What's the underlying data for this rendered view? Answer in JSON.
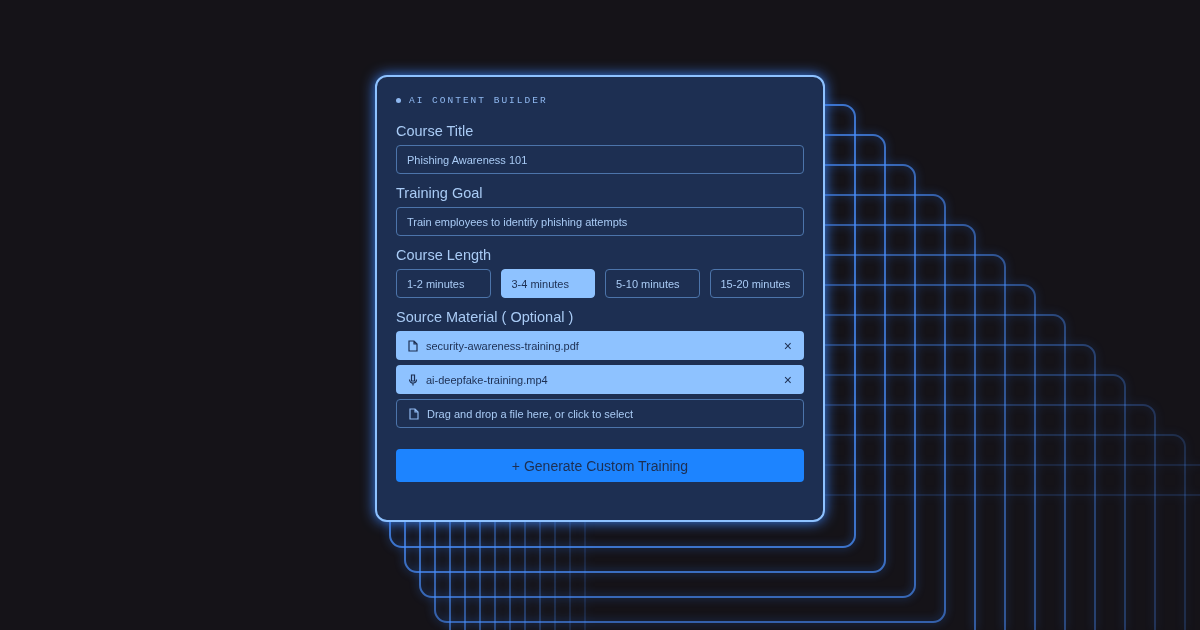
{
  "header": {
    "label": "AI CONTENT BUILDER"
  },
  "course_title": {
    "label": "Course Title",
    "value": "Phishing Awareness 101"
  },
  "training_goal": {
    "label": "Training Goal",
    "value": "Train employees to identify phishing attempts"
  },
  "course_length": {
    "label": "Course Length",
    "options": [
      {
        "label": "1-2 minutes",
        "selected": false
      },
      {
        "label": "3-4 minutes",
        "selected": true
      },
      {
        "label": "5-10 minutes",
        "selected": false
      },
      {
        "label": "15-20 minutes",
        "selected": false
      }
    ]
  },
  "source_material": {
    "label": "Source Material ( Optional )",
    "files": [
      {
        "kind": "document",
        "name": "security-awareness-training.pdf",
        "remove": "×"
      },
      {
        "kind": "audio",
        "name": "ai-deepfake-training.mp4",
        "remove": "×"
      }
    ],
    "dropzone": "Drag and drop a file here, or click to select"
  },
  "generate_button": "+ Generate Custom Training"
}
